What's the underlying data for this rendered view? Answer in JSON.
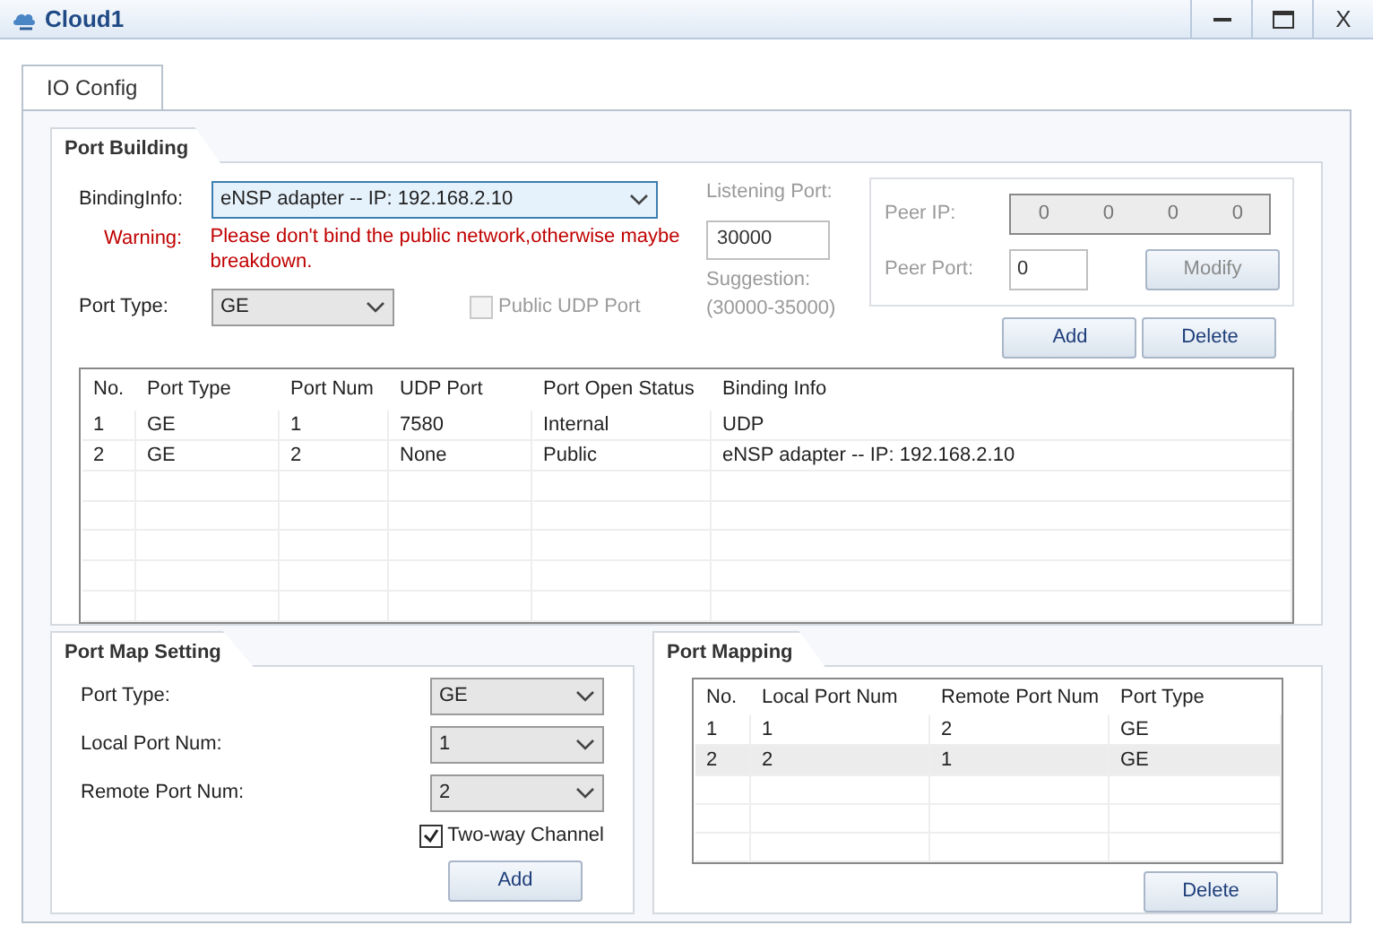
{
  "window": {
    "title": "Cloud1",
    "close": "X"
  },
  "tabs": [
    {
      "label": "IO Config",
      "selected": true
    }
  ],
  "port_building": {
    "title": "Port Building",
    "binding_info": {
      "label": "BindingInfo:",
      "value": "eNSP adapter -- IP: 192.168.2.10"
    },
    "warning": {
      "label": "Warning:",
      "text": "Please don't bind the public network,otherwise maybe breakdown."
    },
    "port_type": {
      "label": "Port Type:",
      "value": "GE"
    },
    "public_udp_port": {
      "label": "Public UDP Port",
      "checked": false,
      "disabled": true
    },
    "listening_port": {
      "label": "Listening Port:",
      "value": "30000",
      "suggestion": "Suggestion:",
      "range": "(30000-35000)",
      "disabled": true
    },
    "peer": {
      "disabled": true,
      "ip_label": "Peer IP:",
      "ip": [
        "0",
        "0",
        "0",
        "0"
      ],
      "port_label": "Peer Port:",
      "port": "0",
      "modify": "Modify"
    },
    "buttons": [
      "Add",
      "Delete"
    ],
    "table": {
      "columns": [
        "No.",
        "Port Type",
        "Port Num",
        "UDP Port",
        "Port Open Status",
        "Binding Info"
      ],
      "rows": [
        [
          "1",
          "GE",
          "1",
          "7580",
          "Internal",
          "UDP"
        ],
        [
          "2",
          "GE",
          "2",
          "None",
          "Public",
          "eNSP adapter -- IP: 192.168.2.10"
        ]
      ]
    }
  },
  "port_map_setting": {
    "title": "Port Map Setting",
    "fields": [
      {
        "label": "Port Type:",
        "value": "GE"
      },
      {
        "label": "Local Port Num:",
        "value": "1"
      },
      {
        "label": "Remote Port Num:",
        "value": "2"
      }
    ],
    "two_way": {
      "label": "Two-way Channel",
      "checked": true
    },
    "button": "Add"
  },
  "port_mapping": {
    "title": "Port Mapping",
    "table": {
      "columns": [
        "No.",
        "Local Port Num",
        "Remote Port Num",
        "Port Type"
      ],
      "rows": [
        {
          "cells": [
            "1",
            "1",
            "2",
            "GE"
          ],
          "selected": false
        },
        {
          "cells": [
            "2",
            "2",
            "1",
            "GE"
          ],
          "selected": true
        }
      ]
    },
    "button": "Delete"
  }
}
